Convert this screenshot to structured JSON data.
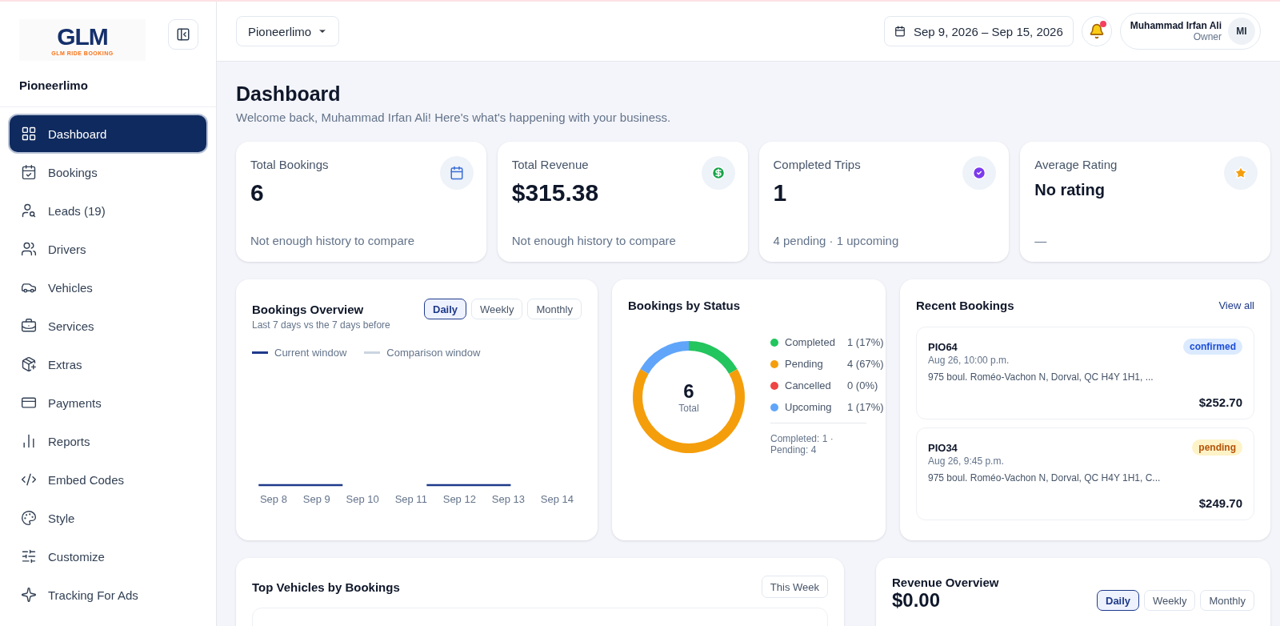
{
  "sidebar": {
    "brand": {
      "logo_text": "GLM",
      "tagline": "GLM RIDE BOOKING"
    },
    "company": "Pioneerlimo",
    "items": [
      {
        "label": "Dashboard",
        "selected": true
      },
      {
        "label": "Bookings",
        "selected": false
      },
      {
        "label": "Leads (19)",
        "selected": false
      },
      {
        "label": "Drivers",
        "selected": false
      },
      {
        "label": "Vehicles",
        "selected": false
      },
      {
        "label": "Services",
        "selected": false
      },
      {
        "label": "Extras",
        "selected": false
      },
      {
        "label": "Payments",
        "selected": false
      },
      {
        "label": "Reports",
        "selected": false
      },
      {
        "label": "Embed Codes",
        "selected": false
      },
      {
        "label": "Style",
        "selected": false
      },
      {
        "label": "Customize",
        "selected": false
      },
      {
        "label": "Tracking For Ads",
        "selected": false
      }
    ]
  },
  "header": {
    "workspace": "Pioneerlimo",
    "date_range": "Sep 9, 2026 – Sep 15, 2026",
    "notifications_unread": true,
    "user": {
      "name": "Muhammad Irfan Ali",
      "role": "Owner",
      "initials": "MI"
    }
  },
  "page": {
    "title": "Dashboard",
    "subtitle": "Welcome back, Muhammad Irfan Ali! Here's what's happening with your business."
  },
  "stats": [
    {
      "label": "Total Bookings",
      "value": "6",
      "note": "Not enough history to compare"
    },
    {
      "label": "Total Revenue",
      "value": "$315.38",
      "note": "Not enough history to compare"
    },
    {
      "label": "Completed Trips",
      "value": "1",
      "note": "4 pending · 1 upcoming"
    },
    {
      "label": "Average Rating",
      "value": "No rating",
      "note": "—"
    }
  ],
  "bookings_overview": {
    "title": "Bookings Overview",
    "subtitle": "Last 7 days vs the 7 days before",
    "tabs": [
      {
        "label": "Daily",
        "selected": true
      },
      {
        "label": "Weekly",
        "selected": false
      },
      {
        "label": "Monthly",
        "selected": false
      }
    ],
    "legend": [
      {
        "label": "Current window",
        "color": "#1e3a8a"
      },
      {
        "label": "Comparison window",
        "color": "#cbd5e1"
      }
    ],
    "x_labels": [
      "Sep 8",
      "Sep 9",
      "Sep 10",
      "Sep 11",
      "Sep 12",
      "Sep 13",
      "Sep 14"
    ]
  },
  "bookings_by_status": {
    "title": "Bookings by Status",
    "total": "6",
    "total_label": "Total",
    "chart_data": {
      "type": "donut",
      "categories": [
        "Completed",
        "Pending",
        "Cancelled",
        "Upcoming"
      ],
      "values": [
        16.67,
        66.66,
        0,
        16.67
      ]
    },
    "legend": [
      {
        "reading": "1 (17%)",
        "color": "#22c55e"
      },
      {
        "reading": "4 (67%)",
        "color": "#f59e0b"
      },
      {
        "reading": "0 (0%)",
        "color": "#ef4444"
      },
      {
        "reading": "1 (17%)",
        "color": "#60a5fa"
      }
    ],
    "summary": "Completed: 1 · Pending: 4"
  },
  "recent_bookings": {
    "title": "Recent Bookings",
    "link": "View all",
    "items": [
      {
        "id": "PIO64",
        "status": "confirmed",
        "date": "Aug 26, 10:00 p.m.",
        "address": "975 boul. Roméo-Vachon N, Dorval, QC H4Y 1H1, ...",
        "amount": "$252.70"
      },
      {
        "id": "PIO34",
        "status": "pending",
        "date": "Aug 26, 9:45 p.m.",
        "address": "975 boul. Roméo-Vachon N, Dorval, QC H4Y 1H1, C...",
        "amount": "$249.70"
      }
    ]
  },
  "top_vehicles": {
    "title": "Top Vehicles by Bookings",
    "button": "This Week"
  },
  "revenue_overview": {
    "title": "Revenue Overview",
    "value": "$0.00",
    "tabs": [
      {
        "label": "Daily",
        "selected": true
      },
      {
        "label": "Weekly",
        "selected": false
      },
      {
        "label": "Monthly",
        "selected": false
      }
    ]
  }
}
